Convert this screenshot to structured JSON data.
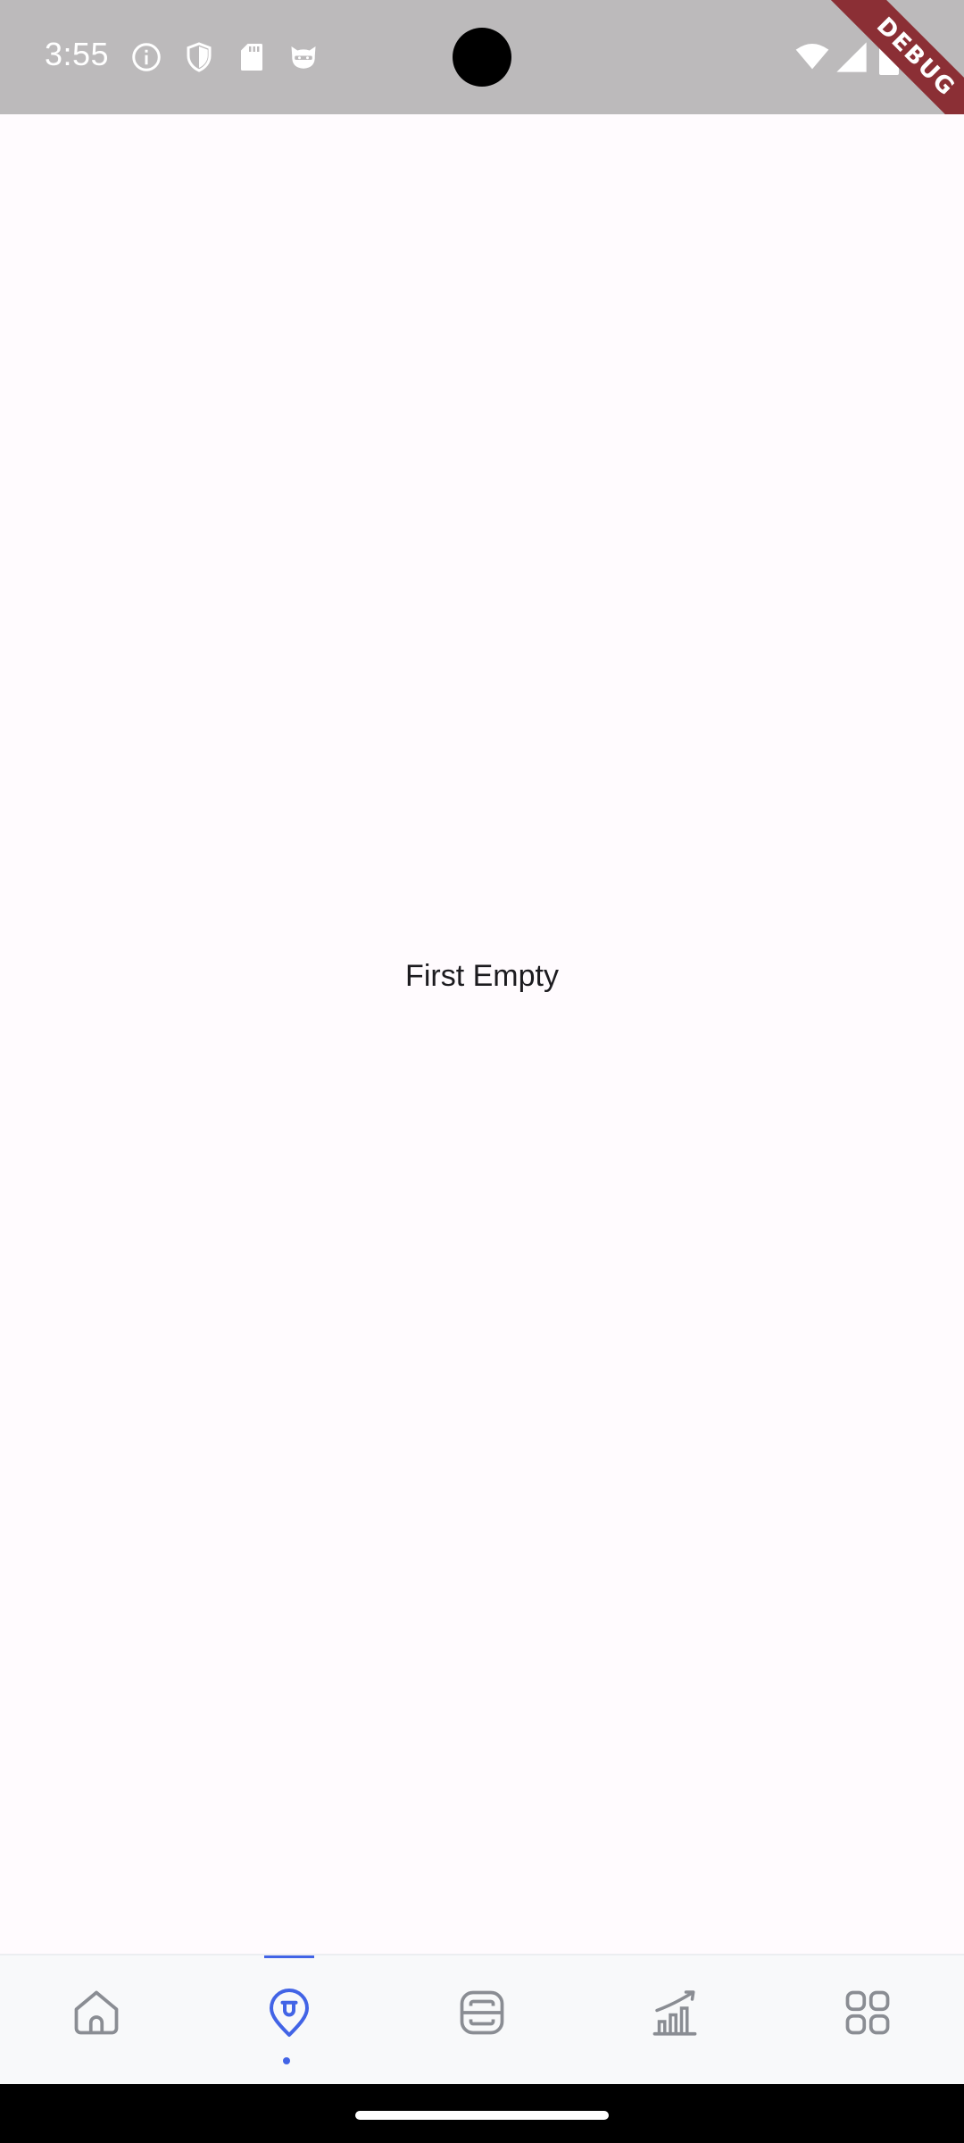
{
  "status_bar": {
    "time": "3:55",
    "icons": [
      "info-icon",
      "shield-icon",
      "sd-card-icon",
      "cat-face-icon",
      "wifi-icon",
      "cellular-signal-icon",
      "battery-icon"
    ]
  },
  "debug_banner": {
    "label": "DEBUG"
  },
  "main": {
    "empty_text": "First Empty"
  },
  "bottom_nav": {
    "active_index": 1,
    "active_color": "#4264e6",
    "inactive_color": "#8a8d93",
    "items": [
      {
        "icon": "home-icon",
        "active": false
      },
      {
        "icon": "location-pin-icon",
        "active": true
      },
      {
        "icon": "scan-icon",
        "active": false
      },
      {
        "icon": "chart-growth-icon",
        "active": false
      },
      {
        "icon": "grid-apps-icon",
        "active": false
      }
    ]
  }
}
